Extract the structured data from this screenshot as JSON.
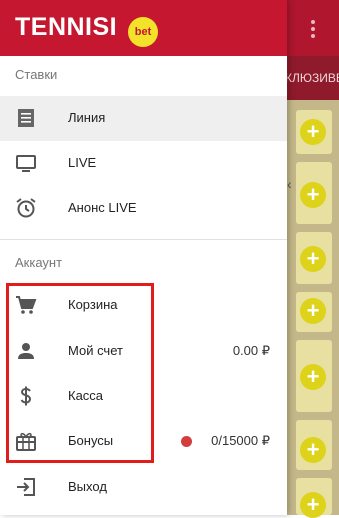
{
  "header": {
    "logo_text": "TENNISI",
    "logo_badge": "bet"
  },
  "background": {
    "tab_text": "КЛЮЗИВЕ"
  },
  "sections": {
    "stakes": "Ставки",
    "account": "Аккаунт"
  },
  "stakes_items": [
    {
      "label": "Линия",
      "icon": "receipt-icon"
    },
    {
      "label": "LIVE",
      "icon": "monitor-icon"
    },
    {
      "label": "Анонс LIVE",
      "icon": "alarm-clock-icon"
    }
  ],
  "account_items": [
    {
      "label": "Корзина",
      "icon": "cart-icon"
    },
    {
      "label": "Мой счет",
      "icon": "person-icon",
      "value": "0.00 ₽"
    },
    {
      "label": "Касса",
      "icon": "dollar-icon"
    },
    {
      "label": "Бонусы",
      "icon": "gift-icon",
      "value": "0/15000 ₽",
      "status_color": "#d33d3d"
    },
    {
      "label": "Выход",
      "icon": "logout-icon"
    }
  ],
  "colors": {
    "brand_red": "#c5172f",
    "badge_yellow": "#f2e22a",
    "highlight_red": "#e21b1b"
  }
}
